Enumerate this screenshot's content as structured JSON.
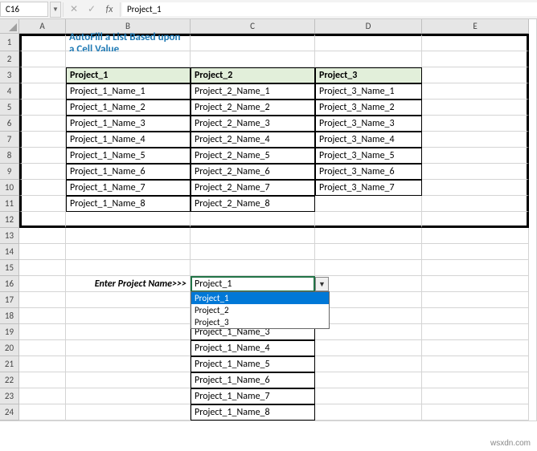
{
  "formula_bar": {
    "name_box": "C16",
    "cancel": "✕",
    "confirm": "✓",
    "fx": "fx",
    "formula": "Project_1"
  },
  "columns": [
    "A",
    "B",
    "C",
    "D",
    "E"
  ],
  "rows": [
    "1",
    "2",
    "3",
    "4",
    "5",
    "6",
    "7",
    "8",
    "9",
    "10",
    "11",
    "12",
    "13",
    "14",
    "15",
    "16",
    "17",
    "18",
    "19",
    "20",
    "21",
    "22",
    "23",
    "24"
  ],
  "title": "AutoFill a List Based upon a Cell Value",
  "table": {
    "headers": [
      "Project_1",
      "Project_2",
      "Project_3"
    ],
    "rows": [
      [
        "Project_1_Name_1",
        "Project_2_Name_1",
        "Project_3_Name_1"
      ],
      [
        "Project_1_Name_2",
        "Project_2_Name_2",
        "Project_3_Name_2"
      ],
      [
        "Project_1_Name_3",
        "Project_2_Name_3",
        "Project_3_Name_3"
      ],
      [
        "Project_1_Name_4",
        "Project_2_Name_4",
        "Project_3_Name_4"
      ],
      [
        "Project_1_Name_5",
        "Project_2_Name_5",
        "Project_3_Name_5"
      ],
      [
        "Project_1_Name_6",
        "Project_2_Name_6",
        "Project_3_Name_6"
      ],
      [
        "Project_1_Name_7",
        "Project_2_Name_7",
        "Project_3_Name_7"
      ],
      [
        "Project_1_Name_8",
        "Project_2_Name_8",
        ""
      ]
    ]
  },
  "prompt_label": "Enter Project Name>>>",
  "dropdown": {
    "value": "Project_1",
    "options": [
      "Project_1",
      "Project_2",
      "Project_3"
    ]
  },
  "autofill": [
    "Project_1_Name_3",
    "Project_1_Name_4",
    "Project_1_Name_5",
    "Project_1_Name_6",
    "Project_1_Name_7",
    "Project_1_Name_8"
  ],
  "watermark": "wsxdn.com"
}
